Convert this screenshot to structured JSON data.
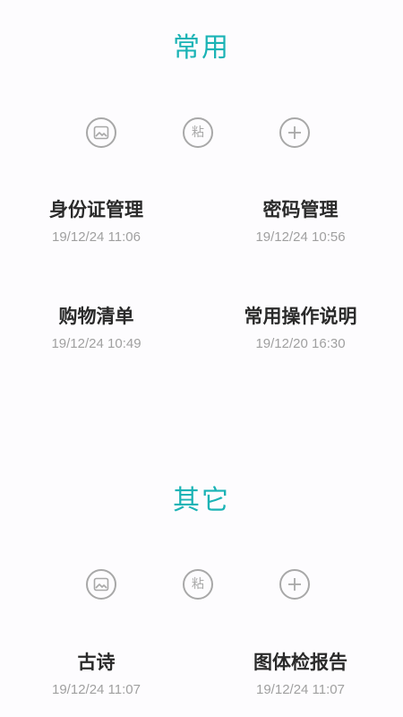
{
  "sections": [
    {
      "title": "常用",
      "actions": {
        "image_icon": "image-icon",
        "paste_label": "粘",
        "add_icon": "plus-icon"
      },
      "notes": [
        {
          "title": "身份证管理",
          "time": "19/12/24 11:06"
        },
        {
          "title": "密码管理",
          "time": "19/12/24 10:56"
        },
        {
          "title": "购物清单",
          "time": "19/12/24 10:49"
        },
        {
          "title": "常用操作说明",
          "time": "19/12/20 16:30"
        }
      ]
    },
    {
      "title": "其它",
      "actions": {
        "image_icon": "image-icon",
        "paste_label": "粘",
        "add_icon": "plus-icon"
      },
      "notes": [
        {
          "title": "古诗",
          "time": "19/12/24 11:07"
        },
        {
          "title": "图体检报告",
          "time": "19/12/24 11:07"
        }
      ]
    }
  ],
  "colors": {
    "accent": "#1ab3b5",
    "icon": "#a8a8a8",
    "title_text": "#2a2a2a",
    "time_text": "#a0a0a0",
    "background": "#fdfcfe"
  }
}
